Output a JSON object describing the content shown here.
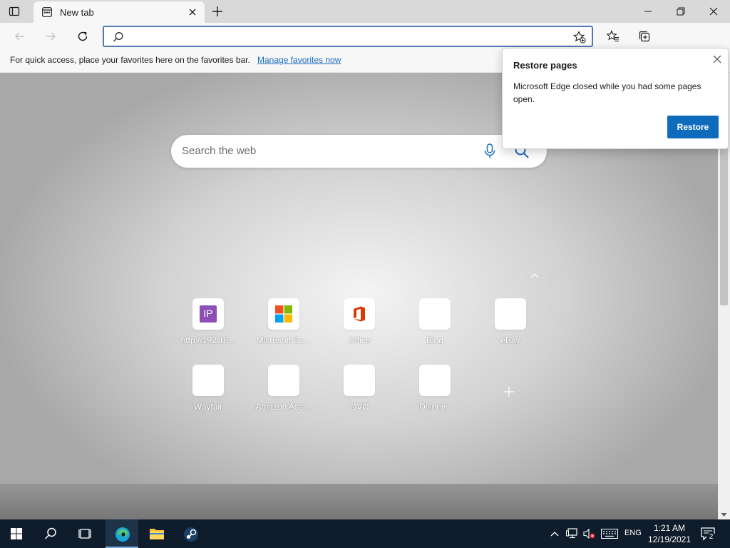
{
  "browser": {
    "tab": {
      "title": "New tab"
    },
    "address_bar": {
      "value": "",
      "placeholder": ""
    },
    "favorites_bar": {
      "message": "For quick access, place your favorites here on the favorites bar.",
      "link": "Manage favorites now"
    }
  },
  "new_tab_page": {
    "search": {
      "placeholder": "Search the web"
    },
    "quick_links": [
      {
        "label": "http://192.16...",
        "icon": "ip-icon"
      },
      {
        "label": "Microsoft Su...",
        "icon": "microsoft-logo-icon"
      },
      {
        "label": "Office",
        "icon": "office-logo-icon"
      },
      {
        "label": "Bing",
        "icon": "blank-icon"
      },
      {
        "label": "eBay",
        "icon": "blank-icon"
      },
      {
        "label": "Wayfair",
        "icon": "blank-icon"
      },
      {
        "label": "Amazon Assi...",
        "icon": "blank-icon"
      },
      {
        "label": "QVC",
        "icon": "blank-icon"
      },
      {
        "label": "Disney+",
        "icon": "blank-icon"
      }
    ],
    "ip_badge_text": "IP"
  },
  "restore_popup": {
    "title": "Restore pages",
    "body": "Microsoft Edge closed while you had some pages open.",
    "button": "Restore"
  },
  "taskbar": {
    "language": "ENG",
    "time": "1:21 AM",
    "date": "12/19/2021",
    "notification_count": "2"
  },
  "colors": {
    "accent": "#0f6cbd",
    "link": "#1a6dbd",
    "taskbar": "#0f1c2b",
    "address_focus": "#4f79b5"
  }
}
